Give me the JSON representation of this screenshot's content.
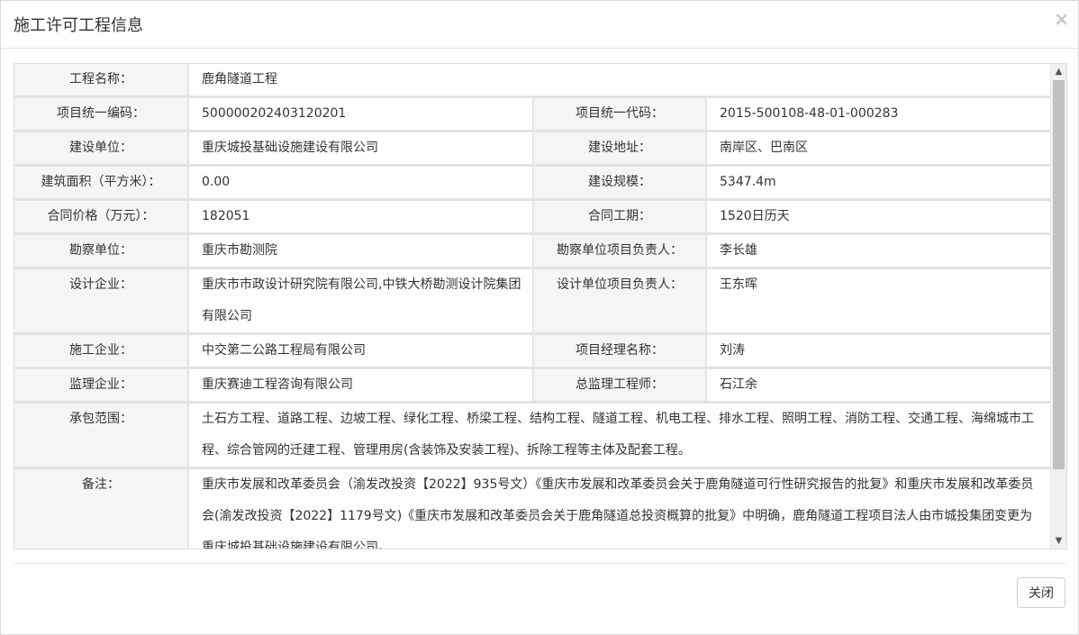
{
  "dialog": {
    "title": "施工许可工程信息",
    "close_icon": "×",
    "close_button_label": "关闭"
  },
  "rows": {
    "project_name": {
      "label": "工程名称：",
      "value": "鹿角隧道工程"
    },
    "unified_number": {
      "label": "项目统一编码：",
      "value": "500000202403120201"
    },
    "unified_code": {
      "label": "项目统一代码：",
      "value": "2015-500108-48-01-000283"
    },
    "construction_unit": {
      "label": "建设单位：",
      "value": "重庆城投基础设施建设有限公司"
    },
    "construction_address": {
      "label": "建设地址：",
      "value": "南岸区、巴南区"
    },
    "building_area": {
      "label": "建筑面积（平方米）：",
      "value": "0.00"
    },
    "construction_scale": {
      "label": "建设规模：",
      "value": "5347.4m"
    },
    "contract_price": {
      "label": "合同价格（万元）：",
      "value": "182051"
    },
    "contract_period": {
      "label": "合同工期：",
      "value": "1520日历天"
    },
    "survey_unit": {
      "label": "勘察单位：",
      "value": "重庆市勘测院"
    },
    "survey_leader": {
      "label": "勘察单位项目负责人：",
      "value": "李长雄"
    },
    "design_company": {
      "label": "设计企业：",
      "value": "重庆市市政设计研究院有限公司,中铁大桥勘测设计院集团有限公司"
    },
    "design_leader": {
      "label": "设计单位项目负责人：",
      "value": "王东晖"
    },
    "construction_company": {
      "label": "施工企业：",
      "value": "中交第二公路工程局有限公司"
    },
    "project_manager": {
      "label": "项目经理名称：",
      "value": "刘涛"
    },
    "supervision_company": {
      "label": "监理企业：",
      "value": "重庆赛迪工程咨询有限公司"
    },
    "chief_supervisor": {
      "label": "总监理工程师：",
      "value": "石江余"
    },
    "contract_scope": {
      "label": "承包范围：",
      "value": "土石方工程、道路工程、边坡工程、绿化工程、桥梁工程、结构工程、隧道工程、机电工程、排水工程、照明工程、消防工程、交通工程、海绵城市工程、综合管网的迁建工程、管理用房(含装饰及安装工程)、拆除工程等主体及配套工程。"
    },
    "remarks": {
      "label": "备注：",
      "value": "重庆市发展和改革委员会（渝发改投资【2022】935号文）《重庆市发展和改革委员会关于鹿角隧道可行性研究报告的批复》和重庆市发展和改革委员会(渝发改投资【2022】1179号文)《重庆市发展和改革委员会关于鹿角隧道总投资概算的批复》中明确，鹿角隧道工程项目法人由市城投集团变更为重庆城投基础设施建设有限公司。"
    }
  },
  "scrollbar": {
    "up_icon": "▲",
    "down_icon": "▼",
    "scroll_position": 0
  }
}
